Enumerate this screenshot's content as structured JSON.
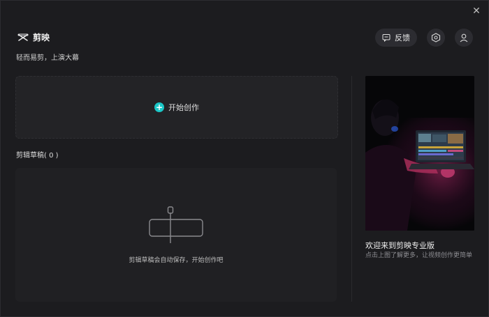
{
  "app": {
    "name": "剪映",
    "slogan": "轻而易剪，上演大幕"
  },
  "header": {
    "feedback_label": "反馈"
  },
  "create": {
    "label": "开始创作"
  },
  "drafts": {
    "title": "剪辑草稿( 0 )",
    "empty_text": "剪辑草稿会自动保存，开始创作吧"
  },
  "promo": {
    "title": "欢迎来到剪映专业版",
    "description": "点击上图了解更多，让视频创作更简单"
  },
  "colors": {
    "accent": "#1bc7c7",
    "background": "#1c1c1f",
    "card": "#232326"
  },
  "icons": {
    "close": "close-icon",
    "feedback": "chat-icon",
    "settings": "hexagon-settings-icon",
    "user": "user-icon",
    "plus": "plus-icon",
    "empty": "empty-draft-icon"
  }
}
